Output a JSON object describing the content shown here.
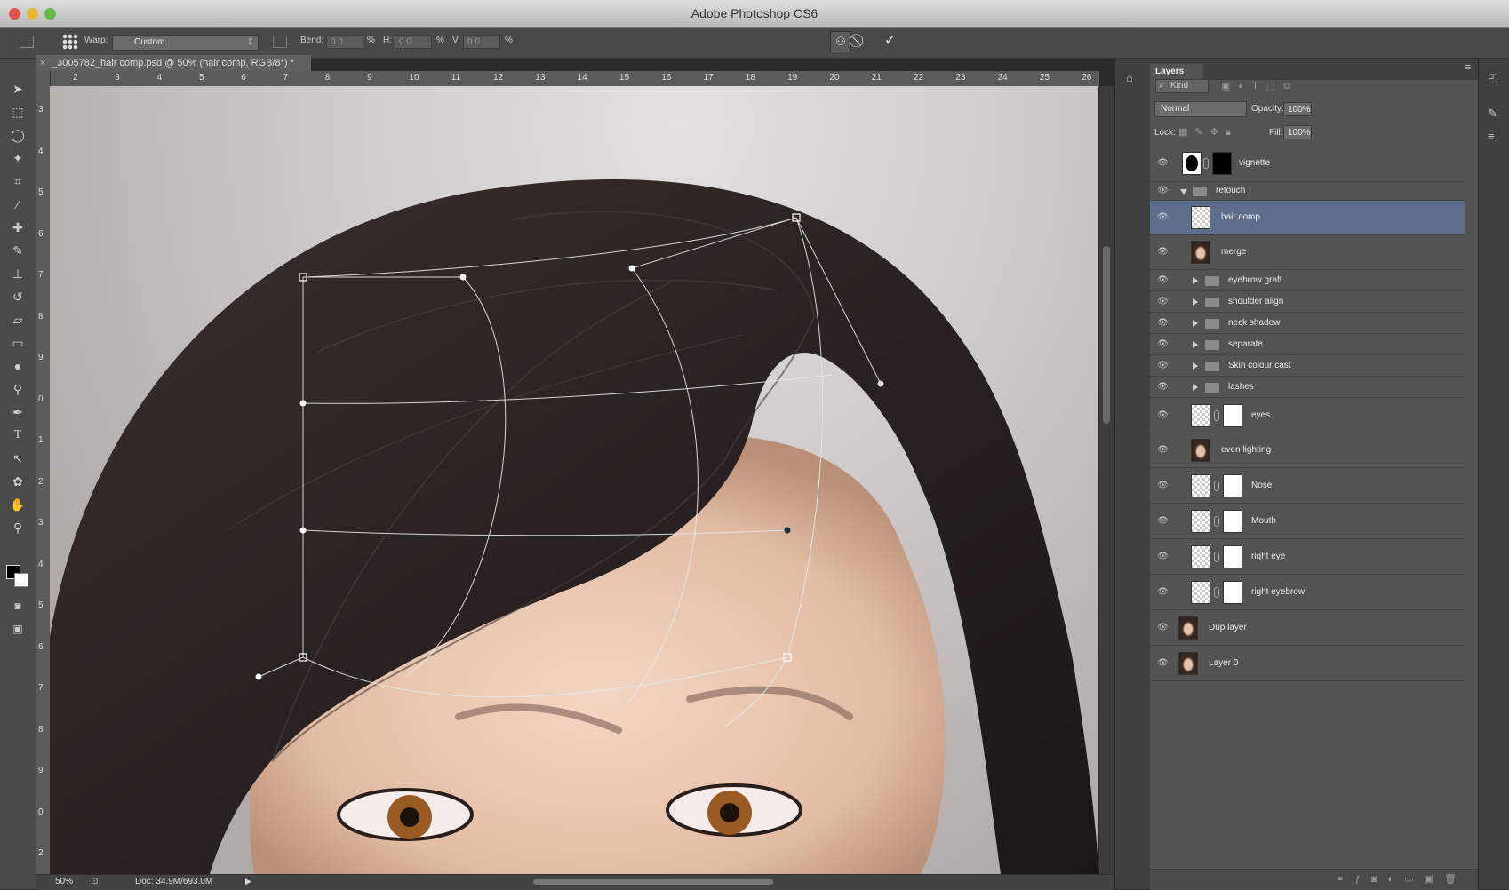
{
  "window": {
    "title": "Adobe Photoshop CS6"
  },
  "options": {
    "warp_label": "Warp:",
    "warp_value": "Custom",
    "bend_label": "Bend:",
    "bend_value": "0.0",
    "h_label": "H:",
    "h_value": "0.0",
    "v_label": "V:",
    "v_value": "0.0",
    "percent": "%"
  },
  "document": {
    "tab": "_3005782_hair comp.psd @ 50% (hair comp, RGB/8*) *"
  },
  "ruler": {
    "h_numbers": [
      "2",
      "3",
      "4",
      "5",
      "6",
      "7",
      "8",
      "9",
      "10",
      "11",
      "12",
      "13",
      "14",
      "15",
      "16",
      "17",
      "18",
      "19",
      "20",
      "21",
      "22",
      "23",
      "24",
      "25",
      "26"
    ],
    "v_numbers": [
      "3",
      "4",
      "5",
      "6",
      "7",
      "8",
      "9",
      "0",
      "1",
      "2",
      "3",
      "4",
      "5",
      "6",
      "7",
      "8",
      "9",
      "0",
      "2"
    ]
  },
  "status": {
    "zoom": "50%",
    "doc": "Doc: 34.9M/693.0M"
  },
  "layers_panel": {
    "tab": "Layers",
    "filter_kind": "Kind",
    "blend_mode": "Normal",
    "opacity_label": "Opacity:",
    "opacity_value": "100%",
    "lock_label": "Lock:",
    "fill_label": "Fill:",
    "fill_value": "100%",
    "layers": [
      {
        "name": "vignette",
        "type": "mask"
      },
      {
        "name": "retouch",
        "type": "group-open"
      },
      {
        "name": "hair comp",
        "type": "pixel",
        "selected": true
      },
      {
        "name": "merge",
        "type": "face"
      },
      {
        "name": "eyebrow graft",
        "type": "group"
      },
      {
        "name": "shoulder align",
        "type": "group"
      },
      {
        "name": "neck shadow",
        "type": "group"
      },
      {
        "name": "separate",
        "type": "group"
      },
      {
        "name": "Skin colour cast",
        "type": "group"
      },
      {
        "name": "lashes",
        "type": "group"
      },
      {
        "name": "eyes",
        "type": "masked"
      },
      {
        "name": "even lighting",
        "type": "face"
      },
      {
        "name": "Nose",
        "type": "masked"
      },
      {
        "name": "Mouth",
        "type": "masked"
      },
      {
        "name": "right eye",
        "type": "masked"
      },
      {
        "name": "right eyebrow",
        "type": "masked"
      },
      {
        "name": "Dup layer",
        "type": "face-top"
      },
      {
        "name": "Layer 0",
        "type": "face-top"
      }
    ]
  },
  "colors": {
    "selected_row": "#5d6e8c",
    "panel_bg": "#535353",
    "chrome": "#494949"
  },
  "icons": [
    "move-icon",
    "marquee-icon",
    "lasso-icon",
    "magic-wand-icon",
    "crop-icon",
    "eyedropper-icon",
    "healing-brush-icon",
    "brush-icon",
    "clone-stamp-icon",
    "history-brush-icon",
    "eraser-icon",
    "gradient-icon",
    "blur-icon",
    "dodge-icon",
    "pen-icon",
    "type-icon",
    "path-selection-icon",
    "shape-icon",
    "hand-icon",
    "zoom-icon"
  ]
}
